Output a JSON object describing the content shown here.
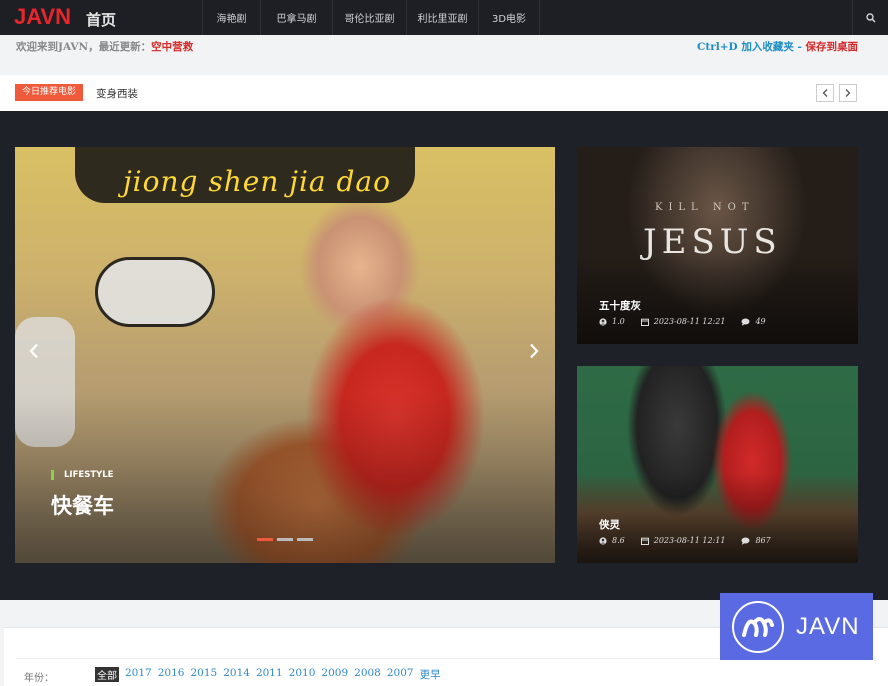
{
  "nav": {
    "logo": "JAVN",
    "home": "首页",
    "items": [
      "海艳剧",
      "巴拿马剧",
      "哥伦比亚剧",
      "利比里亚剧",
      "3D电影"
    ]
  },
  "welcome": {
    "prefix": "欢迎来到JAVN，最近更新：",
    "latest": "空中营救",
    "bookmark": "Ctrl+D 加入收藏夹 - ",
    "desktop": "保存到桌面"
  },
  "ticker": {
    "badge": "今日推荐电影",
    "text": "变身西装"
  },
  "slider": {
    "poster_text": "jiong shen jia dao",
    "category": "LIFESTYLE",
    "title": "快餐车",
    "active_index": 0,
    "dot_count": 3
  },
  "cards": [
    {
      "poster_small": "KILL NOT",
      "poster_big": "JESUS",
      "title": "五十度灰",
      "rating": "1.0",
      "date": "2023-08-11 12:21",
      "comments": "49"
    },
    {
      "title": "侠灵",
      "rating": "8.6",
      "date": "2023-08-11 12:11",
      "comments": "867"
    }
  ],
  "filter": {
    "label": "年份：",
    "years": [
      "全部",
      "2017",
      "2016",
      "2015",
      "2014",
      "2011",
      "2010",
      "2009",
      "2008",
      "2007",
      "更早"
    ],
    "selected": "全部"
  },
  "watermark": {
    "text": "JAVN"
  },
  "colors": {
    "brand_red": "#e8262c",
    "accent_orange": "#ef5a3a",
    "link_blue": "#2f8ac6",
    "watermark_blue": "#5a6ae3"
  }
}
